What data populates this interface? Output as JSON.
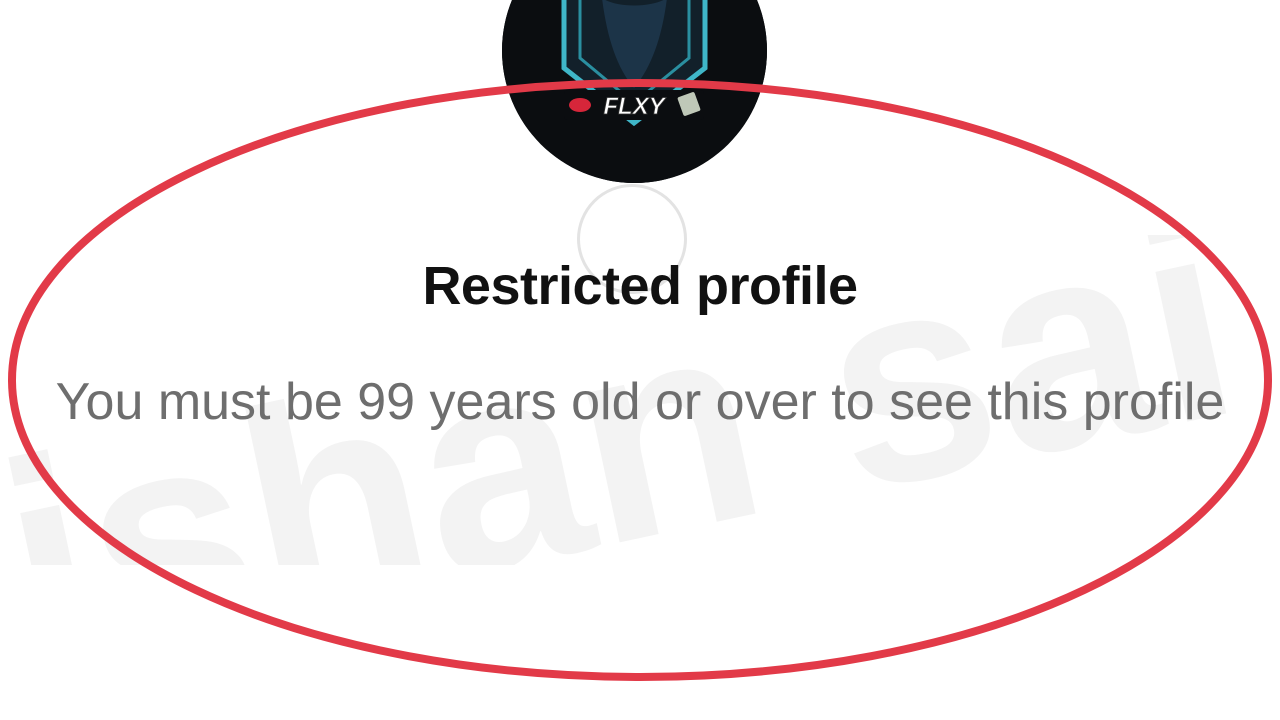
{
  "profile": {
    "avatar_logo_text": "FLXY",
    "title": "Restricted profile",
    "message": "You must be 99 years old or over to see this profile"
  },
  "overlay": {
    "watermark_text": "ishan sai",
    "highlight_color": "#e23a48"
  },
  "icons": {
    "avatar": "hooded-figure-logo",
    "loading": "loading-spinner-icon"
  }
}
